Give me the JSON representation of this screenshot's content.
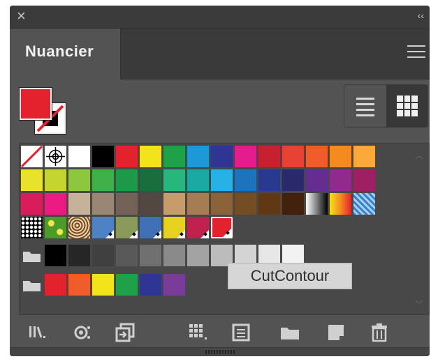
{
  "panel": {
    "close_glyph": "×",
    "collapse_glyph": "‹‹",
    "tab_label": "Nuancier",
    "menu_icon": "hamburger-menu-icon"
  },
  "fill_stroke": {
    "fill_color": "#e3222d",
    "stroke": "none"
  },
  "view_mode": {
    "options": [
      "list-view-icon",
      "grid-view-icon"
    ],
    "selected": "grid-view-icon"
  },
  "swatch_rows": [
    [
      "none",
      "registration",
      "#ffffff",
      "#000000",
      "#e3222d",
      "#f2e31a",
      "#1fa149",
      "#1b9ad7",
      "#2e3592",
      "#e51a8e",
      "#c8202f",
      "#ea4135",
      "#f05b29",
      "#f58b1f",
      "#f8a93a"
    ],
    [
      "#e8e22a",
      "#c4d52f",
      "#8dc63f",
      "#3fb049",
      "#1e9849",
      "#1a6d3c",
      "#27b67b",
      "#1aa9a2",
      "#26b2e7",
      "#1c75bc",
      "#283a8e",
      "#282a6b",
      "#662d91",
      "#922a8e",
      "#9e1f63"
    ],
    [
      "#d91c5c",
      "#ec1b83",
      "#c7b299",
      "#998675",
      "#736357",
      "#534741",
      "#c69c6d",
      "#a67c52",
      "#8c6239",
      "#754c24",
      "#603813",
      "#42210b",
      "gradient-gray",
      "gradient-orange",
      "pattern-blue"
    ],
    [
      "pattern-dots",
      "pattern-leaves",
      "pattern-paisley",
      "#4d82c5",
      "#8a9a5b",
      "#3f6fb5",
      "#e6d11f",
      "#c0204d",
      "#e3222d"
    ]
  ],
  "grays_group": [
    "#000000",
    "#262626",
    "#404040",
    "#595959",
    "#707070",
    "#8a8a8a",
    "#a3a3a3",
    "#bcbcbc",
    "#d4d4d4",
    "#e6e6e6",
    "#f2f2f2"
  ],
  "brights_group": [
    "#e3222d",
    "#f05b29",
    "#f2e31a",
    "#1fa149",
    "#2e3592",
    "#7a3c9b"
  ],
  "tooltip": {
    "text": "CutContour"
  },
  "toolbar": {
    "buttons": [
      "swatch-libraries-icon",
      "show-kinds-icon",
      "place-swatch-icon",
      "new-color-group-icon",
      "swatch-options-icon",
      "folder-icon",
      "new-swatch-icon",
      "trash-icon"
    ]
  }
}
